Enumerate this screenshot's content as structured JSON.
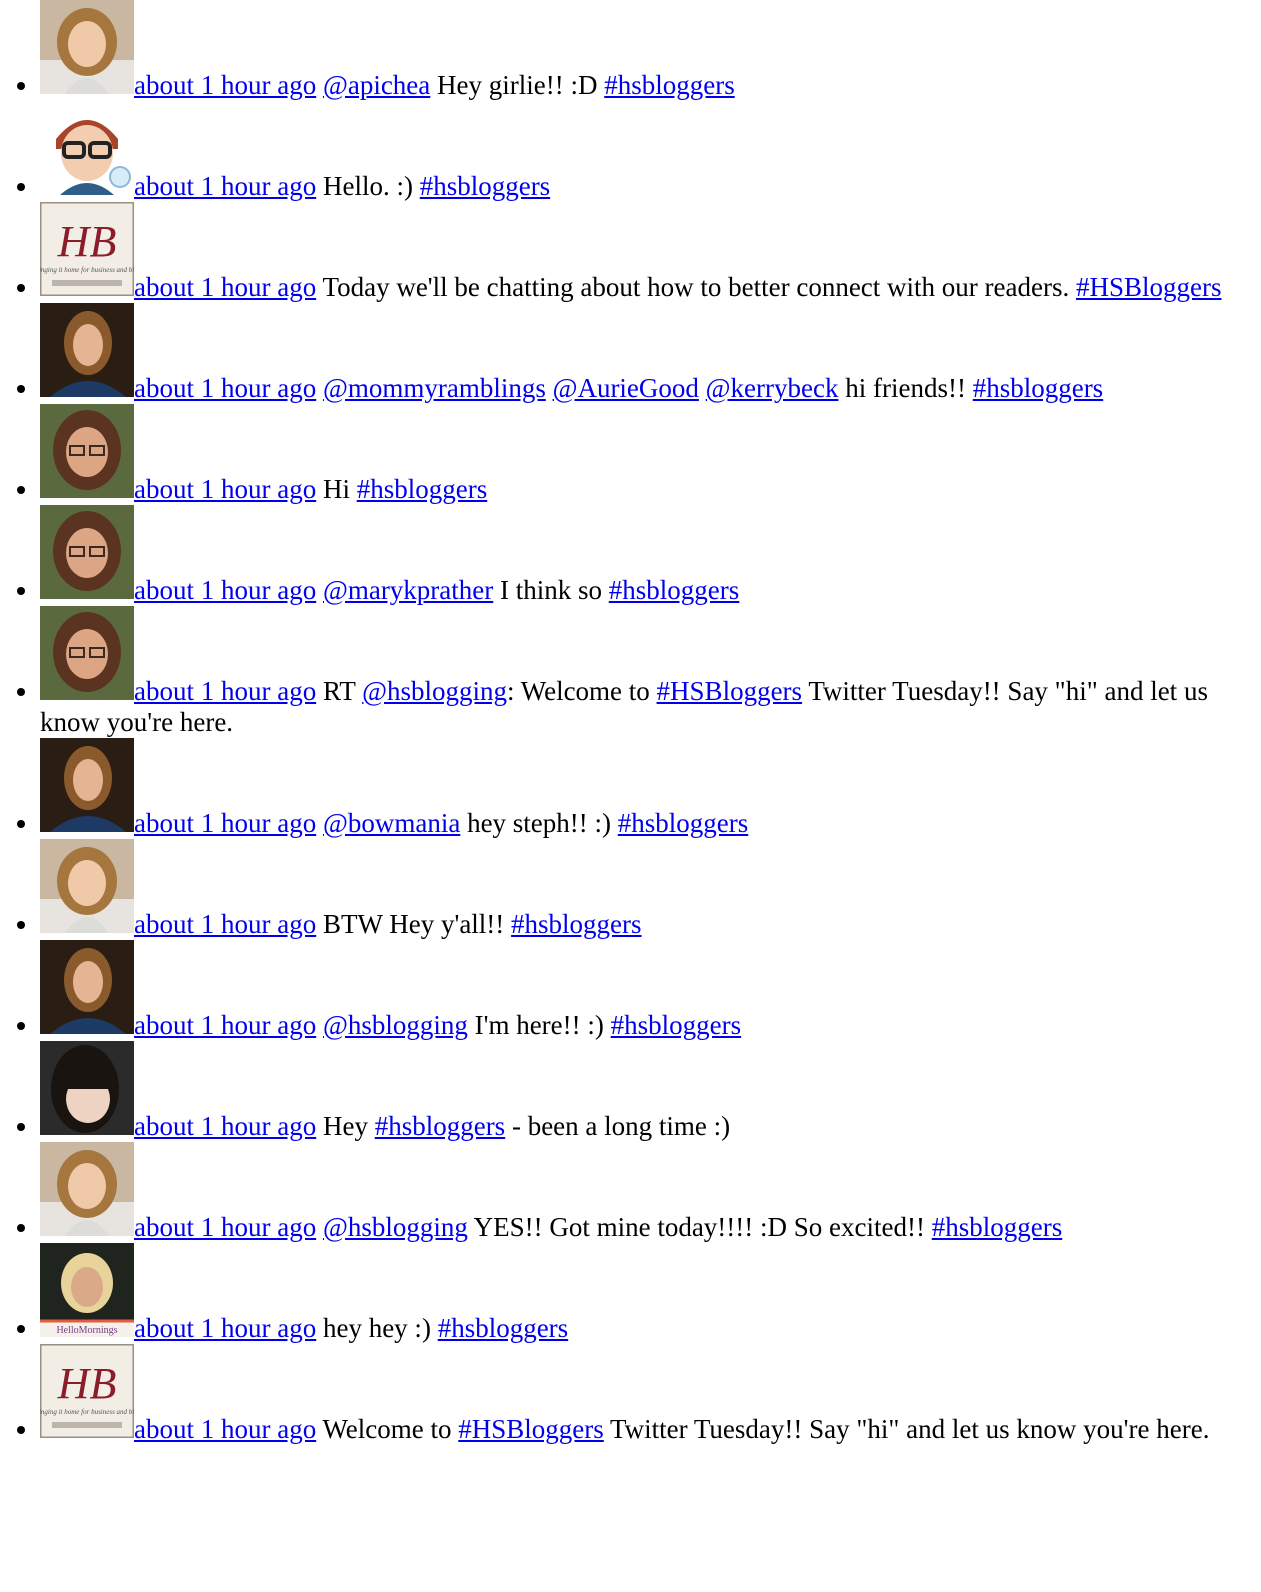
{
  "feed": [
    {
      "avatar": "avatar-woman-curly-hair",
      "time": "about 1 hour ago",
      "parts": [
        [
          "link",
          "@apichea"
        ],
        [
          "text",
          " Hey girlie!! :D "
        ],
        [
          "link",
          "#hsbloggers"
        ]
      ]
    },
    {
      "avatar": "avatar-cartoon-glasses",
      "time": "about 1 hour ago",
      "parts": [
        [
          "text",
          "Hello. :) "
        ],
        [
          "link",
          "#hsbloggers"
        ]
      ]
    },
    {
      "avatar": "avatar-hb-logo",
      "time": "about 1 hour ago",
      "parts": [
        [
          "text",
          "Today we'll be chatting about how to better connect with our readers. "
        ],
        [
          "link",
          "#HSBloggers"
        ]
      ]
    },
    {
      "avatar": "avatar-woman-dark-bg",
      "time": "about 1 hour ago",
      "parts": [
        [
          "link",
          "@mommyramblings"
        ],
        [
          "text",
          " "
        ],
        [
          "link",
          "@AurieGood"
        ],
        [
          "text",
          " "
        ],
        [
          "link",
          "@kerrybeck"
        ],
        [
          "text",
          " hi friends!! "
        ],
        [
          "link",
          "#hsbloggers"
        ]
      ]
    },
    {
      "avatar": "avatar-woman-glasses",
      "time": "about 1 hour ago",
      "parts": [
        [
          "text",
          "Hi "
        ],
        [
          "link",
          "#hsbloggers"
        ]
      ]
    },
    {
      "avatar": "avatar-woman-glasses",
      "time": "about 1 hour ago",
      "parts": [
        [
          "link",
          "@marykprather"
        ],
        [
          "text",
          " I think so "
        ],
        [
          "link",
          "#hsbloggers"
        ]
      ]
    },
    {
      "avatar": "avatar-woman-glasses",
      "time": "about 1 hour ago",
      "parts": [
        [
          "text",
          "RT "
        ],
        [
          "link",
          "@hsblogging"
        ],
        [
          "text",
          ": Welcome to "
        ],
        [
          "link",
          "#HSBloggers"
        ],
        [
          "text",
          " Twitter Tuesday!! Say \"hi\" and let us know you're here."
        ]
      ]
    },
    {
      "avatar": "avatar-woman-dark-bg",
      "time": "about 1 hour ago",
      "parts": [
        [
          "link",
          "@bowmania"
        ],
        [
          "text",
          " hey steph!! :) "
        ],
        [
          "link",
          "#hsbloggers"
        ]
      ]
    },
    {
      "avatar": "avatar-woman-curly-hair",
      "time": "about 1 hour ago",
      "parts": [
        [
          "text",
          "BTW Hey y'all!! "
        ],
        [
          "link",
          "#hsbloggers"
        ]
      ]
    },
    {
      "avatar": "avatar-woman-dark-bg",
      "time": "about 1 hour ago",
      "parts": [
        [
          "link",
          "@hsblogging"
        ],
        [
          "text",
          " I'm here!! :) "
        ],
        [
          "link",
          "#hsbloggers"
        ]
      ]
    },
    {
      "avatar": "avatar-woman-bangs",
      "time": "about 1 hour ago",
      "parts": [
        [
          "text",
          "Hey "
        ],
        [
          "link",
          "#hsbloggers"
        ],
        [
          "text",
          " - been a long time :)"
        ]
      ]
    },
    {
      "avatar": "avatar-woman-curly-hair",
      "time": "about 1 hour ago",
      "parts": [
        [
          "link",
          "@hsblogging"
        ],
        [
          "text",
          " YES!! Got mine today!!!! :D So excited!! "
        ],
        [
          "link",
          "#hsbloggers"
        ]
      ]
    },
    {
      "avatar": "avatar-hello-mornings",
      "time": "about 1 hour ago",
      "parts": [
        [
          "text",
          "hey hey :) "
        ],
        [
          "link",
          "#hsbloggers"
        ]
      ]
    },
    {
      "avatar": "avatar-hb-logo",
      "time": "about 1 hour ago",
      "parts": [
        [
          "text",
          "Welcome to "
        ],
        [
          "link",
          "#HSBloggers"
        ],
        [
          "text",
          " Twitter Tuesday!! Say \"hi\" and let us know you're here."
        ]
      ]
    }
  ],
  "avatar_art": {
    "avatar-hb-logo": {
      "letters": "HB",
      "caption": "bringing it home for business and blog"
    },
    "avatar-hello-mornings": {
      "banner": "HelloMornings"
    }
  },
  "colors": {
    "link": "#0000ee",
    "text": "#000000",
    "background": "#ffffff"
  }
}
